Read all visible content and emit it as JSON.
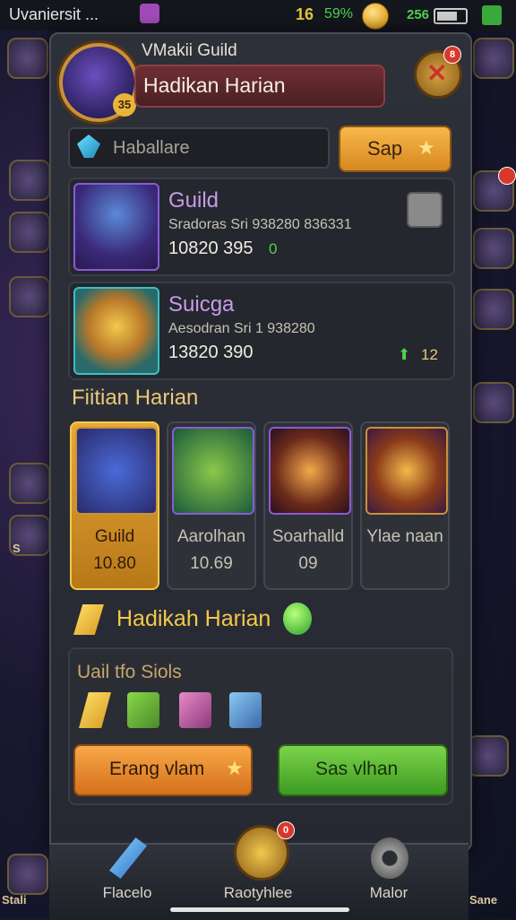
{
  "status_bar": {
    "title": "Uvaniersit ...",
    "level": "16",
    "percent": "59%",
    "gems": "256"
  },
  "side_left": {
    "labels": [
      "Stali",
      "S"
    ]
  },
  "side_right": {
    "labels": [
      "Sane"
    ]
  },
  "header": {
    "guild_name": "VMakii Guild",
    "title": "Hadikan Harian",
    "emblem_level": "35",
    "close_badge": "8"
  },
  "search": {
    "placeholder": "Haballare",
    "button_label": "Sap"
  },
  "cards": [
    {
      "title": "Guild",
      "subtitle": "Sradoras Sri 938280 836331",
      "stat": "10820 395",
      "extra": "0"
    },
    {
      "title": "Suicga",
      "subtitle": "Aesodran Sri 1 938280",
      "stat": "13820 390",
      "extra": "12"
    }
  ],
  "section_title": "Fiitian Harian",
  "tiles": [
    {
      "name": "Guild",
      "value": "10.80"
    },
    {
      "name": "Aarolhan",
      "value": "10.69"
    },
    {
      "name": "Soarhalld",
      "value": "09"
    },
    {
      "name": "Ylae naan",
      "value": ""
    }
  ],
  "daily": {
    "label": "Hadikah Harian"
  },
  "rewards": {
    "title": "Uail tfo Siols",
    "button_orange": "Erang vlam",
    "button_green": "Sas vlhan"
  },
  "bottom_nav": [
    {
      "label": "Flacelo",
      "icon": "sword-icon"
    },
    {
      "label": "Raotyhlee",
      "icon": "crest-icon",
      "badge": "0"
    },
    {
      "label": "Malor",
      "icon": "gear-icon"
    }
  ],
  "colors": {
    "accent_gold": "#f2c94c",
    "accent_purple": "#c89be8",
    "button_orange": "#f7a847",
    "button_green": "#7cd44a",
    "banner_red": "#6e2f34"
  }
}
